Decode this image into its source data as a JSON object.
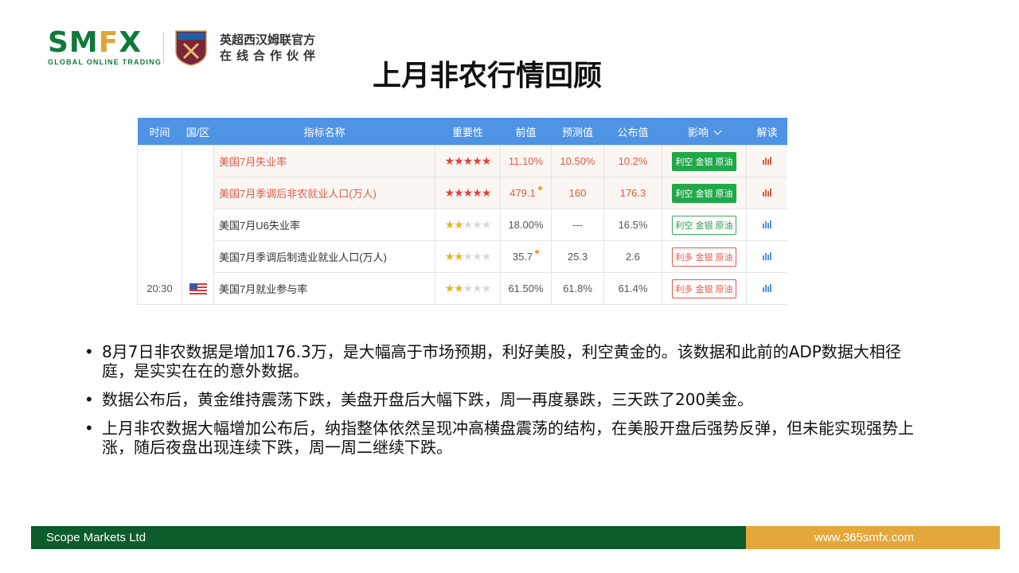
{
  "header": {
    "brand_logo_a": "SM",
    "brand_logo_f": "F",
    "brand_logo_x": "X",
    "brand_tagline": "GLOBAL ONLINE TRADING",
    "crest_text": "WEST HAM UNITED",
    "partner_line1": "英超西汉姆联官方",
    "partner_line2": "在线合作伙伴"
  },
  "title": "上月非农行情回顾",
  "table": {
    "headers": [
      "时间",
      "国/区",
      "指标名称",
      "重要性",
      "前值",
      "预测值",
      "公布值",
      "影响",
      "解读"
    ],
    "rows": [
      {
        "name": "美国7月失业率",
        "prev": "11.10%",
        "forecast": "10.50%",
        "actual": "10.2%",
        "impact": "利空 金银 原油"
      },
      {
        "name": "美国7月季调后非农就业人口(万人)",
        "prev": "479.1",
        "forecast": "160",
        "actual": "176.3",
        "impact": "利空 金银 原油"
      },
      {
        "name": "美国7月U6失业率",
        "prev": "18.00%",
        "forecast": "---",
        "actual": "16.5%",
        "impact": "利空 金银 原油"
      },
      {
        "name": "美国7月季调后制造业就业人口(万人)",
        "prev": "35.7",
        "forecast": "25.3",
        "actual": "2.6",
        "impact": "利多 金银 原油"
      },
      {
        "name": "美国7月就业参与率",
        "prev": "61.50%",
        "forecast": "61.8%",
        "actual": "61.4%",
        "impact": "利多 金银 原油"
      }
    ],
    "time": "20:30",
    "importance": [
      5,
      5,
      2,
      2,
      2
    ],
    "colors": {
      "header": "#4e93e4",
      "bearish": "#20a84a",
      "bullish": "#e05a4a"
    }
  },
  "bullets": [
    "8月7日非农数据是增加176.3万，是大幅高于市场预期，利好美股，利空黄金的。该数据和此前的ADP数据大相径庭，是实实在在的意外数据。",
    "数据公布后，黄金维持震荡下跌，美盘开盘后大幅下跌，周一再度暴跌，三天跌了200美金。",
    "上月非农数据大幅增加公布后，纳指整体依然呈现冲高横盘震荡的结构，在美股开盘后强势反弹，但未能实现强势上涨，随后夜盘出现连续下跌，周一周二继续下跌。"
  ],
  "footer": {
    "company": "Scope Markets Ltd",
    "url": "www.365smfx.com",
    "colors": {
      "left": "#0d5c2c",
      "right": "#e4a73a"
    }
  }
}
